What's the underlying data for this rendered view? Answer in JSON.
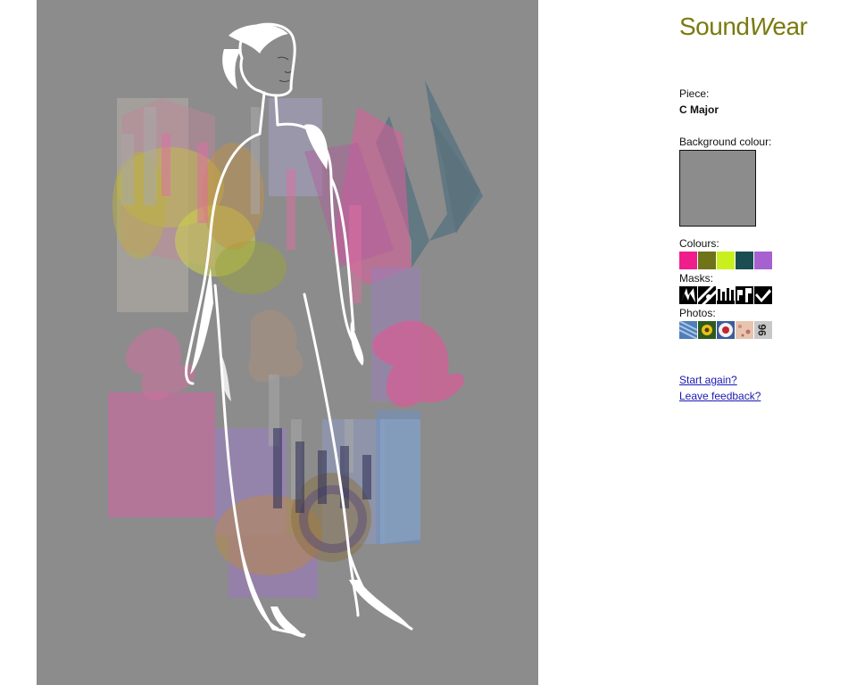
{
  "brand": {
    "part1": "Sound",
    "part2": "W",
    "part3": "ear"
  },
  "piece": {
    "label": "Piece:",
    "value": "C Major"
  },
  "background": {
    "label": "Background colour:",
    "color": "#8c8c8c"
  },
  "colours": {
    "label": "Colours:",
    "swatches": [
      "#f01e8c",
      "#6f7319",
      "#c9f01e",
      "#1a4e52",
      "#a760cf"
    ]
  },
  "masks": {
    "label": "Masks:",
    "icons": [
      "mask-zigzag-icon",
      "mask-stripes-icon",
      "mask-bars-icon",
      "mask-pattern-icon",
      "mask-check-icon"
    ]
  },
  "photos": {
    "label": "Photos:",
    "thumb_4_text": "96"
  },
  "links": {
    "start_again": "Start again?",
    "feedback": "Leave feedback?"
  }
}
